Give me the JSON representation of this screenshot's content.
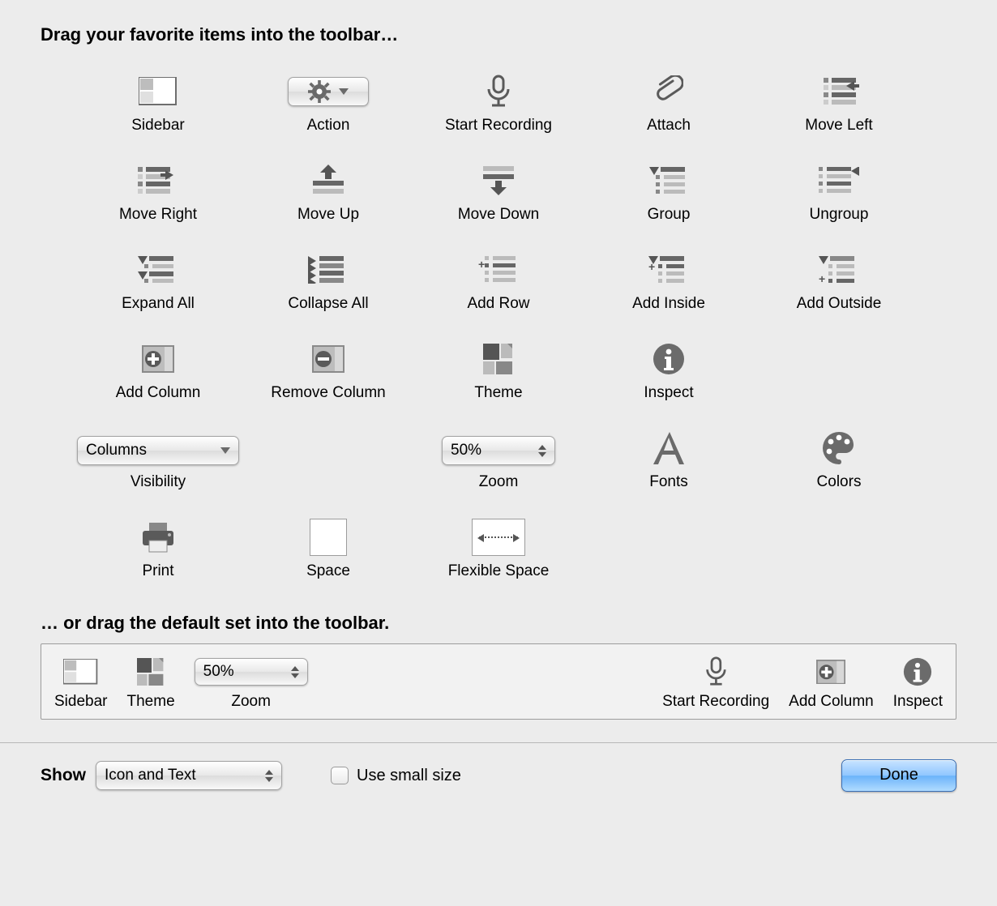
{
  "heading": "Drag your favorite items into the toolbar…",
  "subheading": "… or drag the default set into the toolbar.",
  "items": {
    "sidebar": "Sidebar",
    "action": "Action",
    "start_recording": "Start Recording",
    "attach": "Attach",
    "move_left": "Move Left",
    "move_right": "Move Right",
    "move_up": "Move Up",
    "move_down": "Move Down",
    "group": "Group",
    "ungroup": "Ungroup",
    "expand_all": "Expand All",
    "collapse_all": "Collapse All",
    "add_row": "Add Row",
    "add_inside": "Add Inside",
    "add_outside": "Add Outside",
    "add_column": "Add Column",
    "remove_column": "Remove Column",
    "theme": "Theme",
    "inspect": "Inspect",
    "visibility": "Visibility",
    "visibility_value": "Columns",
    "zoom": "Zoom",
    "zoom_value": "50%",
    "fonts": "Fonts",
    "colors": "Colors",
    "print": "Print",
    "space": "Space",
    "flexible_space": "Flexible Space"
  },
  "defaults": {
    "sidebar": "Sidebar",
    "theme": "Theme",
    "zoom": "Zoom",
    "zoom_value": "50%",
    "start_recording": "Start Recording",
    "add_column": "Add Column",
    "inspect": "Inspect"
  },
  "footer": {
    "show_label": "Show",
    "show_value": "Icon and Text",
    "small_size_label": "Use small size",
    "done": "Done"
  }
}
